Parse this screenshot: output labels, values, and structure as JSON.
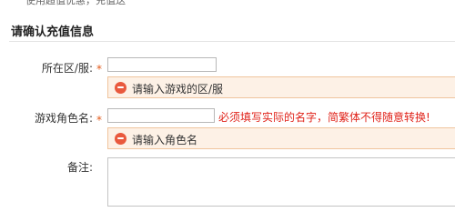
{
  "top_clipped_text": "使用超值优惠，充值送",
  "section_title": "请确认充值信息",
  "fields": {
    "server": {
      "label": "所在区/服:",
      "value": "",
      "required_mark": "*",
      "error": "请输入游戏的区/服"
    },
    "role": {
      "label": "游戏角色名:",
      "value": "",
      "required_mark": "*",
      "hint": "必须填写实际的名字，简繁体不得随意转换!",
      "error": "请输入角色名"
    },
    "note": {
      "label": "备注:",
      "value": ""
    }
  },
  "colors": {
    "required_star": "#e25a1b",
    "hint_red": "#e0241b",
    "error_bg": "#fdf1e6",
    "error_border": "#f0c49d",
    "error_icon": "#e9593d"
  },
  "icons": {
    "error_icon": "error-minus-circle-icon"
  }
}
